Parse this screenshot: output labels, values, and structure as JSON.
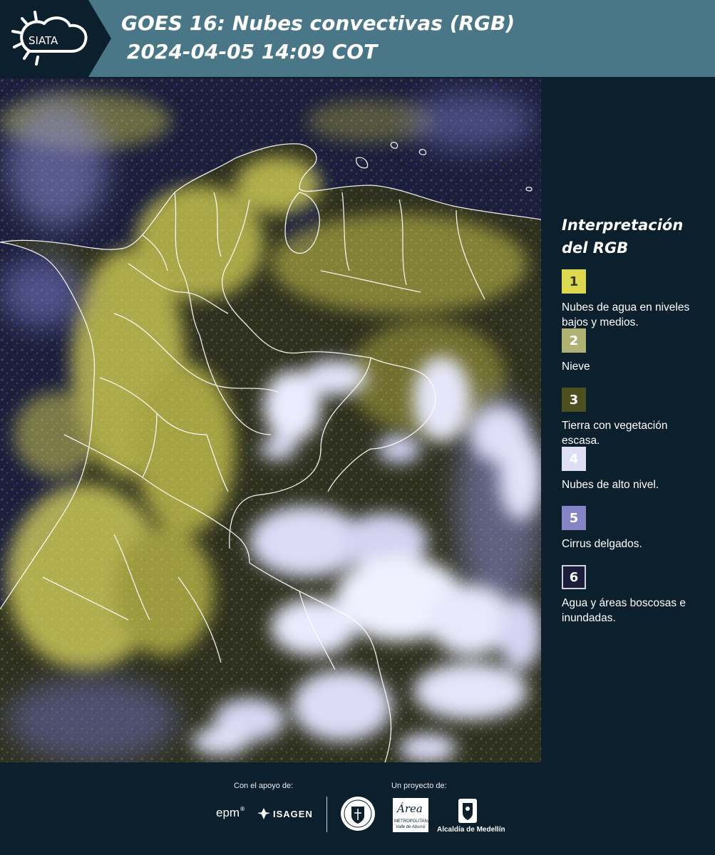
{
  "header": {
    "logo_text": "SIATA",
    "title_line1": "GOES 16: Nubes convectivas (RGB)",
    "title_line2": "2024-04-05 14:09 COT"
  },
  "map": {
    "palette": {
      "ocean": "#1b1e3d",
      "land_dark": "#2e3020",
      "low_cloud": "#e0dc5a",
      "high_cloud": "#e6e6fa",
      "thin_cirrus": "#8c8cd2",
      "border": "#ffffff"
    }
  },
  "legend": {
    "title_line1": "Interpretación",
    "title_line2": "del RGB",
    "items": [
      {
        "num": "1",
        "label": "Nubes de agua en niveles bajos y medios.",
        "color": "#dcd850",
        "text_color": "#3a3a10"
      },
      {
        "num": "2",
        "label": "Nieve",
        "color": "#b0b274",
        "text_color": "#ffffff"
      },
      {
        "num": "3",
        "label": "Tierra con vegetación escasa.",
        "color": "#4e4f1e",
        "text_color": "#ffffff"
      },
      {
        "num": "4",
        "label": "Nubes de alto nivel.",
        "color": "#dedef6",
        "text_color": "#ffffff"
      },
      {
        "num": "5",
        "label": "Cirrus delgados.",
        "color": "#8585c6",
        "text_color": "#ffffff"
      },
      {
        "num": "6",
        "label": "Agua y áreas boscosas e inundadas.",
        "color": "#1b1d3a",
        "text_color": "#ffffff"
      }
    ]
  },
  "footer": {
    "support_label": "Con el apoyo de:",
    "project_label": "Un proyecto de:",
    "sponsor_epm": "epm",
    "sponsor_isagen": "ISAGEN",
    "area_metro_main": "Área",
    "area_metro_sub": "METROPOLITANA",
    "area_metro_sub2": "Valle de Aburrá",
    "alcaldia": "Alcaldía de Medellín"
  }
}
